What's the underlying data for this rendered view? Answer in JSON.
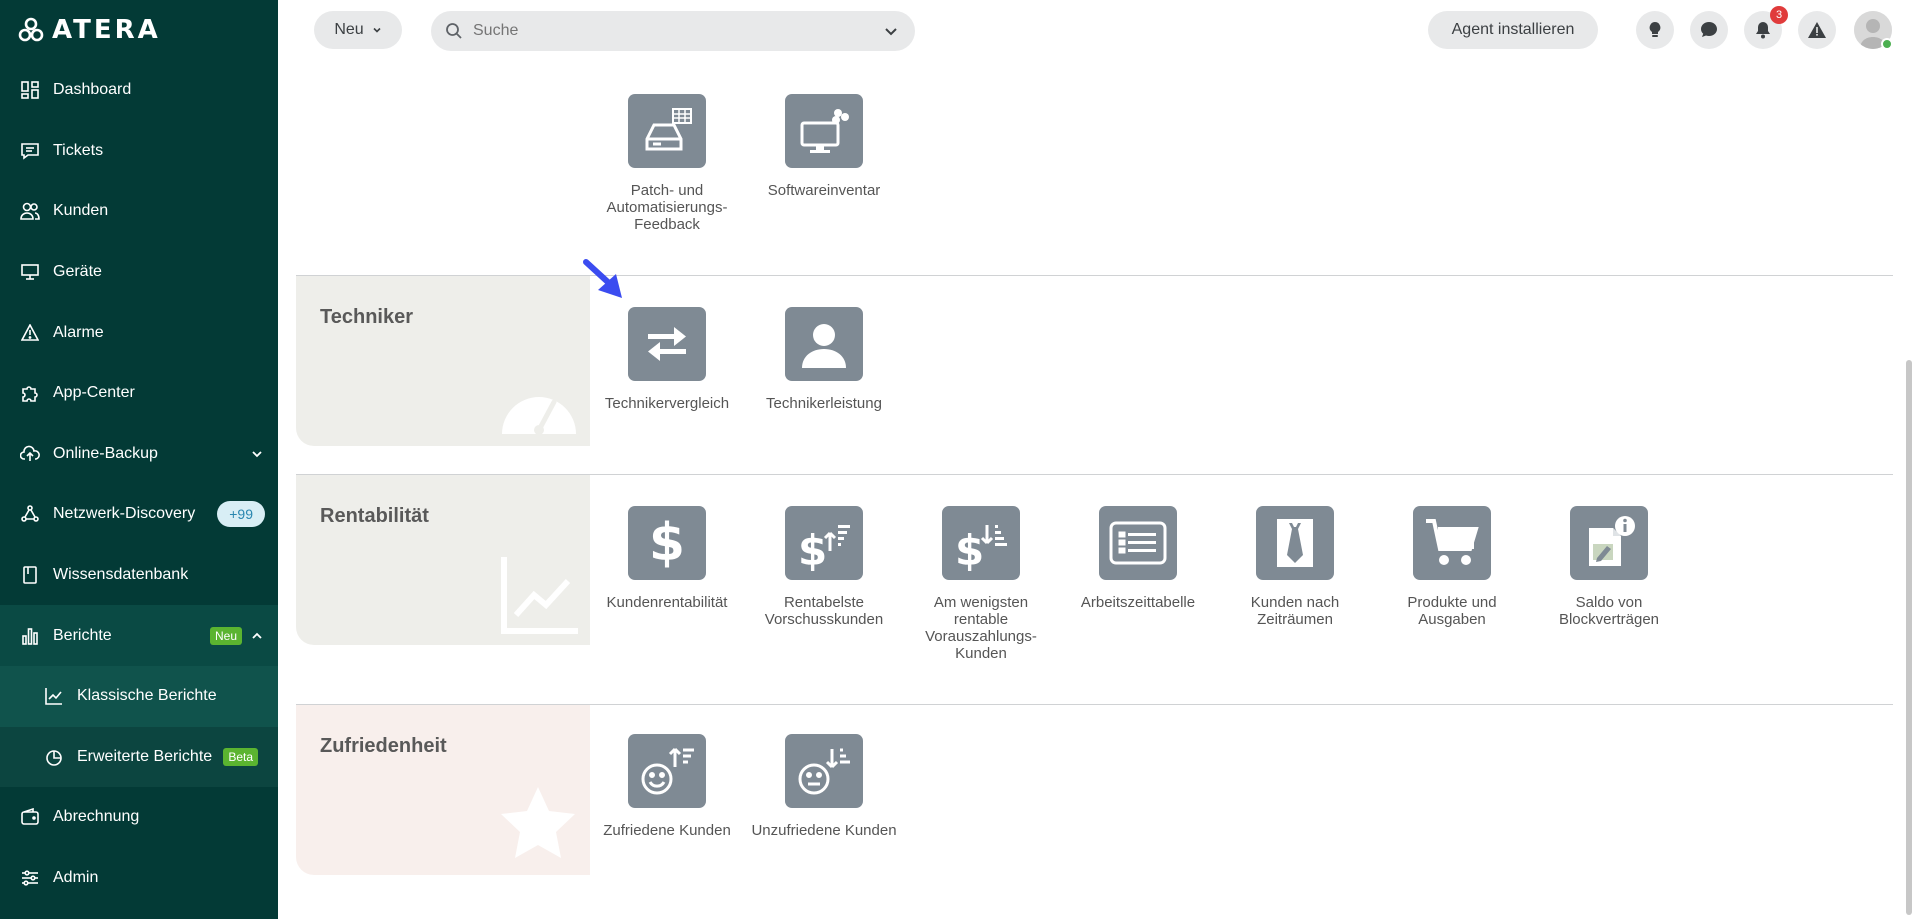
{
  "app": {
    "logo_text": "ATERA"
  },
  "sidebar": {
    "items": [
      {
        "label": "Dashboard",
        "icon": "dashboard-icon"
      },
      {
        "label": "Tickets",
        "icon": "tickets-icon"
      },
      {
        "label": "Kunden",
        "icon": "customers-icon"
      },
      {
        "label": "Geräte",
        "icon": "devices-icon"
      },
      {
        "label": "Alarme",
        "icon": "alerts-icon"
      },
      {
        "label": "App-Center",
        "icon": "puzzle-icon"
      },
      {
        "label": "Online-Backup",
        "icon": "cloud-backup-icon"
      },
      {
        "label": "Netzwerk-Discovery",
        "icon": "network-icon",
        "badge": "+99"
      },
      {
        "label": "Wissensdatenbank",
        "icon": "book-icon"
      },
      {
        "label": "Berichte",
        "icon": "reports-icon",
        "badge": "Neu"
      },
      {
        "label": "Klassische Berichte",
        "icon": "line-chart-icon"
      },
      {
        "label": "Erweiterte Berichte",
        "icon": "pie-chart-icon",
        "badge": "Beta"
      },
      {
        "label": "Abrechnung",
        "icon": "wallet-icon"
      },
      {
        "label": "Admin",
        "icon": "sliders-icon"
      }
    ]
  },
  "topbar": {
    "new_label": "Neu",
    "search_placeholder": "Suche",
    "agent_label": "Agent installieren",
    "notification_count": "3"
  },
  "sections": [
    {
      "title": "",
      "tiles": [
        {
          "label": "Patch- und Automatisierungs-Feedback",
          "icon": "patch-feedback-icon"
        },
        {
          "label": "Softwareinventar",
          "icon": "software-inventory-icon"
        }
      ]
    },
    {
      "title": "Techniker",
      "tiles": [
        {
          "label": "Technikervergleich",
          "icon": "compare-arrows-icon"
        },
        {
          "label": "Technikerleistung",
          "icon": "person-icon"
        }
      ]
    },
    {
      "title": "Rentabilität",
      "tiles": [
        {
          "label": "Kundenrentabilität",
          "icon": "dollar-icon"
        },
        {
          "label": "Rentabelste Vorschusskunden",
          "icon": "dollar-sort-up-icon"
        },
        {
          "label": "Am wenigsten rentable Vorauszahlungs-Kunden",
          "icon": "dollar-sort-down-icon"
        },
        {
          "label": "Arbeitszeittabelle",
          "icon": "timesheet-icon"
        },
        {
          "label": "Kunden nach Zeiträumen",
          "icon": "customer-tie-icon"
        },
        {
          "label": "Produkte und Ausgaben",
          "icon": "cart-icon"
        },
        {
          "label": "Saldo von Blockverträgen",
          "icon": "contract-info-icon"
        }
      ]
    },
    {
      "title": "Zufriedenheit",
      "tiles": [
        {
          "label": "Zufriedene Kunden",
          "icon": "happy-sort-up-icon"
        },
        {
          "label": "Unzufriedene Kunden",
          "icon": "neutral-sort-down-icon"
        }
      ]
    }
  ]
}
